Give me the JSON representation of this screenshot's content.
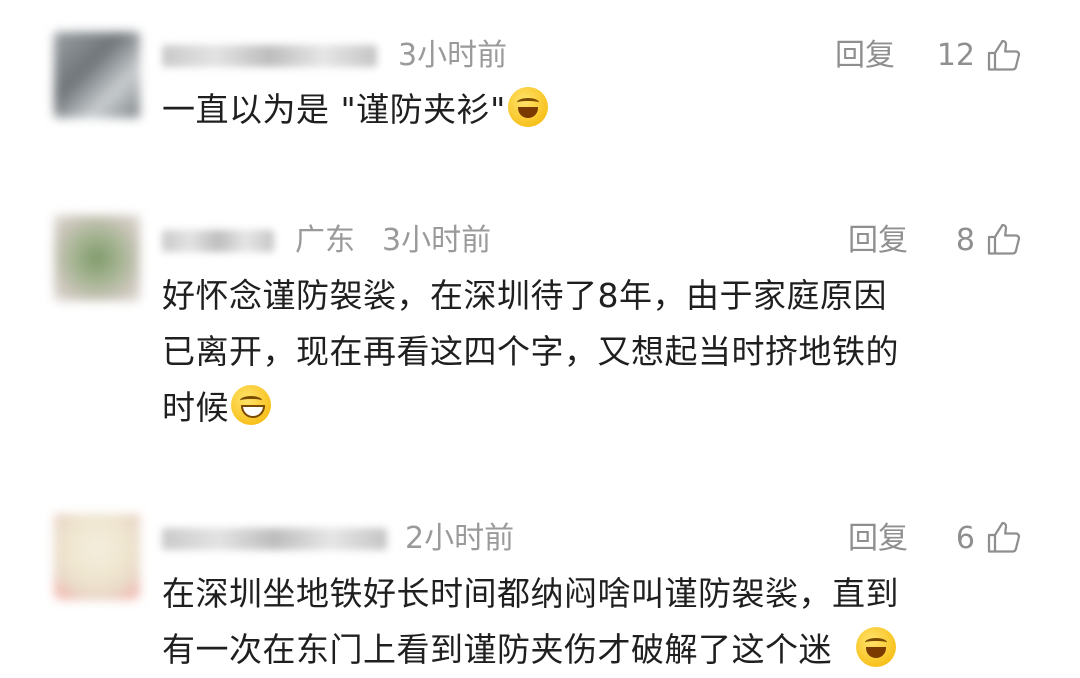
{
  "actions": {
    "reply_label": "回复"
  },
  "comments": [
    {
      "location": "",
      "time": "3小时前",
      "likes": "12",
      "text": "一直以为是 \"谨防夹衫\"",
      "emoji": "laughing-crying-emoji"
    },
    {
      "location": "广东",
      "time": "3小时前",
      "likes": "8",
      "line1": "好怀念谨防袈裟，在深圳待了8年，由于家庭原因",
      "line2": "已离开，现在再看这四个字，又想起当时挤地铁的",
      "line3": "时候",
      "emoji": "grinning-emoji"
    },
    {
      "location": "",
      "time": "2小时前",
      "likes": "6",
      "line1": "在深圳坐地铁好长时间都纳闷啥叫谨防袈裟，直到",
      "line2": "有一次在东门上看到谨防夹伤才破解了这个迷",
      "emoji": "laughing-crying-emoji"
    }
  ],
  "colors": {
    "meta": "#9a9a9a",
    "text": "#1f1f1f",
    "background": "#ffffff"
  }
}
